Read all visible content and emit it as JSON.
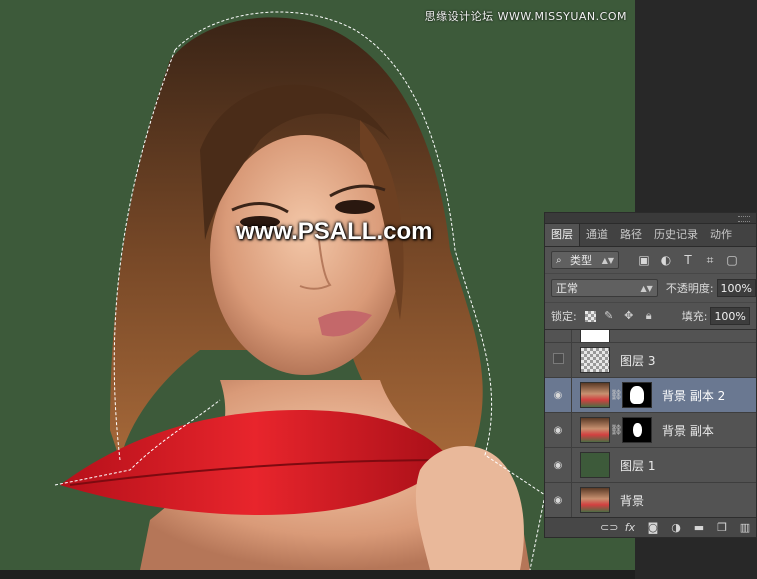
{
  "watermark_top": "思缘设计论坛 WWW.MISSYUAN.COM",
  "watermark_center": "www.PSALL.com",
  "colors": {
    "canvas_bg": "#3d5a3a",
    "selected_layer": "#6a7891",
    "panel_bg": "#535353"
  },
  "panel": {
    "tabs": [
      "图层",
      "通道",
      "路径",
      "历史记录",
      "动作"
    ],
    "active_tab": "图层",
    "filter": {
      "label": "类型",
      "search_icon": "search-icon"
    },
    "filter_icons": [
      "image-filter-icon",
      "adjustment-filter-icon",
      "type-filter-icon",
      "shape-filter-icon",
      "smart-object-filter-icon"
    ],
    "blend_mode": "正常",
    "opacity_label": "不透明度:",
    "opacity_value": "100%",
    "lock_label": "锁定:",
    "fill_label": "填充:",
    "fill_value": "100%",
    "layers": [
      {
        "name": "图层 3",
        "visible": false,
        "thumb": "checker"
      },
      {
        "name": "背景 副本 2",
        "visible": true,
        "thumb": "photo",
        "mask": true,
        "selected": true
      },
      {
        "name": "背景 副本",
        "visible": true,
        "thumb": "photo",
        "mask": true
      },
      {
        "name": "图层 1",
        "visible": true,
        "thumb": "green"
      },
      {
        "name": "背景",
        "visible": true,
        "thumb": "photo"
      }
    ],
    "bottom_icons": [
      "link-icon",
      "fx-icon",
      "mask-icon",
      "adjustment-icon",
      "folder-icon",
      "new-layer-icon",
      "trash-icon"
    ],
    "fx_label": "fx"
  }
}
